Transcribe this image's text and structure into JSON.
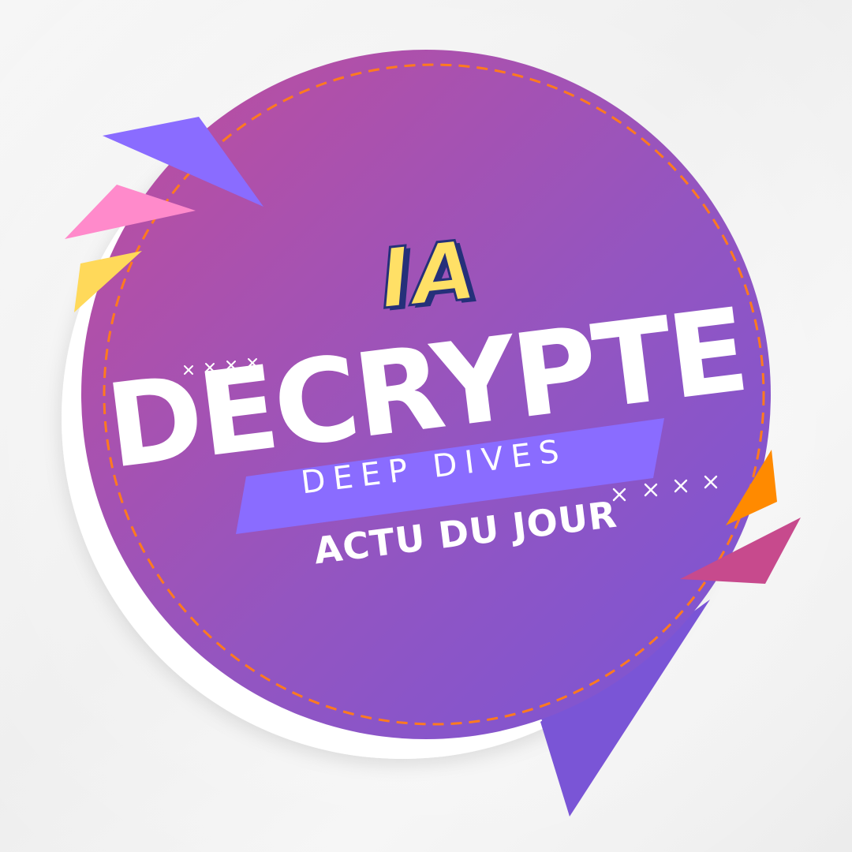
{
  "logo": {
    "title_top": "IA",
    "title_main": "DECRYPTE",
    "subtitle_band": "DEEP DIVES",
    "subtitle_bottom": "ACTU DU JOUR"
  },
  "colors": {
    "circle_gradient_start": "#c04d9c",
    "circle_gradient_end": "#7a55d6",
    "dashed_ring": "#ff7a1f",
    "band": "#8a6cff",
    "title_top_fill": "#ffe066",
    "title_top_outline": "#25307a",
    "confetti_blue": "#8a6cff",
    "confetti_pink": "#ff8acb",
    "confetti_yellow": "#ffd95a",
    "confetti_orange": "#ff8a00",
    "confetti_magenta": "#c74a8d"
  },
  "icons": [
    "cross-mark-icon",
    "confetti-triangle"
  ]
}
